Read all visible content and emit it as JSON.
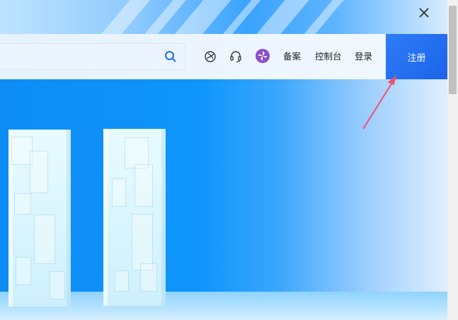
{
  "navbar": {
    "links": {
      "beian": "备案",
      "console": "控制台",
      "login": "登录"
    },
    "register_label": "注册",
    "icons": {
      "search": "search-icon",
      "globe": "globe-icon",
      "support": "headset-icon",
      "app": "pinwheel-app-icon"
    }
  },
  "banner": {
    "close": "close-icon"
  },
  "colors": {
    "accent": "#1b63ea",
    "hero_blue": "#0f95fb",
    "annotation": "#f0506e"
  }
}
